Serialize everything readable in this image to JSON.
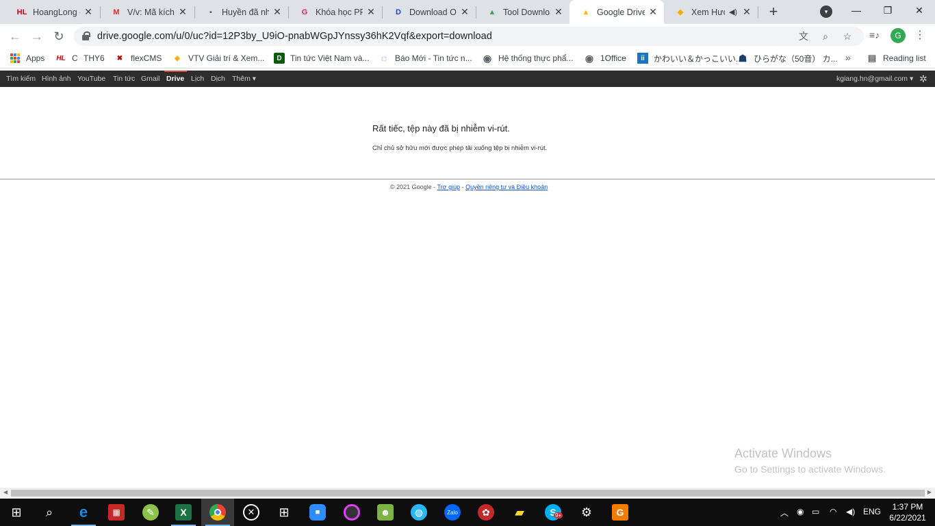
{
  "browser": {
    "tabs": [
      {
        "title": "HoangLong -",
        "icon": "hl-icon",
        "fav_text": "HL",
        "fav_color": "#d00000"
      },
      {
        "title": "V/v: Mã kích h",
        "icon": "gmail-icon",
        "fav_text": "M",
        "fav_color": "#d93025"
      },
      {
        "title": "Huyền đã nhắ",
        "icon": "message-icon",
        "fav_text": "▪",
        "fav_color": "#5f6368"
      },
      {
        "title": "Khóa học PPC",
        "icon": "course-icon",
        "fav_text": "G",
        "fav_color": "#e91e63"
      },
      {
        "title": "Download Off",
        "icon": "download-site-icon",
        "fav_text": "D",
        "fav_color": "#1a3fe0"
      },
      {
        "title": "Tool Downloa",
        "icon": "drive-icon",
        "fav_text": "▲",
        "fav_color": "#34a853"
      },
      {
        "title": "Google Drive",
        "icon": "drive-icon",
        "fav_text": "▲",
        "fav_color": "#fbbc04"
      },
      {
        "title": "Xem Hươ",
        "icon": "box-icon",
        "fav_text": "◆",
        "fav_color": "#f9ab00"
      }
    ],
    "audio_icon": "speaker-icon",
    "url": "drive.google.com/u/0/uc?id=12P3by_U9iO-pnabWGpJYnssy36hK2Vqf&export=download",
    "profile_initial": "G",
    "bookmarks": [
      {
        "label": "Apps",
        "icon": "apps-grid-icon"
      },
      {
        "label": "C",
        "icon": "hl-icon",
        "fav_text": "HL",
        "fav_color": "#d00000"
      },
      {
        "label": "THY6",
        "icon": "none"
      },
      {
        "label": "flexCMS",
        "icon": "flexcms-icon",
        "fav_text": "✖",
        "fav_color": "#c00000"
      },
      {
        "label": "VTV Giải trí & Xem...",
        "icon": "vtv-icon",
        "fav_text": "◆",
        "fav_color": "#f9ab00"
      },
      {
        "label": "Tin tức Việt Nam và...",
        "icon": "dantri-icon",
        "fav_text": "D",
        "fav_color": "#0a5c0a"
      },
      {
        "label": "Báo Mới - Tin tức n...",
        "icon": "baomoi-icon",
        "fav_text": "◌",
        "fav_color": "#1a73e8"
      },
      {
        "label": "Hệ thống thực phẩ...",
        "icon": "globe-icon",
        "fav_text": "◉",
        "fav_color": "#5f6368"
      },
      {
        "label": "1Office",
        "icon": "globe-icon",
        "fav_text": "◉",
        "fav_color": "#5f6368"
      },
      {
        "label": "かわいい＆かっこいい...",
        "icon": "kawaii-icon",
        "fav_text": "ii",
        "fav_color": "#1e73be"
      },
      {
        "label": "ひらがな（50音） カ...",
        "icon": "hiragana-icon",
        "fav_text": "☗",
        "fav_color": "#1a3f6f"
      }
    ],
    "reading_list": "Reading list"
  },
  "google_bar": {
    "links": [
      "Tìm kiếm",
      "Hình ảnh",
      "YouTube",
      "Tin tức",
      "Gmail",
      "Drive",
      "Lịch",
      "Dịch",
      "Thêm ▾"
    ],
    "selected": "Drive",
    "user": "kgiang.hn@gmail.com ▾"
  },
  "content": {
    "title": "Rất tiếc, tệp này đã bị nhiễm vi-rút.",
    "body": "Chỉ chủ sở hữu mới được phép tải xuống tệp bị nhiễm vi-rút.",
    "footer_copyright": "© 2021 Google - ",
    "footer_help": "Trợ giúp",
    "footer_sep": " - ",
    "footer_privacy": "Quyền riêng tư và Điều khoản"
  },
  "watermark": {
    "line1": "Activate Windows",
    "line2": "Go to Settings to activate Windows."
  },
  "taskbar": {
    "language": "ENG",
    "time": "1:37 PM",
    "date": "6/22/2021",
    "skype_badge": "9+",
    "apps": [
      "windows-start-icon",
      "search-icon",
      "edge-icon",
      "office-tool-icon",
      "green-app-icon",
      "excel-icon",
      "chrome-icon",
      "xbox-icon",
      "store-icon",
      "zoom-icon",
      "camera-app-icon",
      "game-icon",
      "globe-app-icon",
      "zalo-icon",
      "ball-icon",
      "folder-icon",
      "skype-icon",
      "settings-icon",
      "pdf-icon"
    ]
  }
}
